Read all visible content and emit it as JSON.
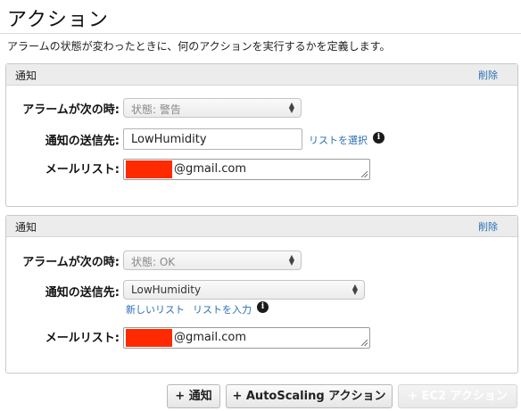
{
  "section": {
    "title": "アクション",
    "description": "アラームの状態が変わったときに、何のアクションを実行するかを定義します。"
  },
  "actions": [
    {
      "header": "通知",
      "delete_label": "削除",
      "alarm_label": "アラームが次の時:",
      "state_value": "状態: 警告",
      "send_to_label": "通知の送信先:",
      "send_to_value": "LowHumidity",
      "select_list_link": "リストを選択",
      "email_label": "メールリスト:",
      "email_value": "@gmail.com"
    },
    {
      "header": "通知",
      "delete_label": "削除",
      "alarm_label": "アラームが次の時:",
      "state_value": "状態: OK",
      "send_to_label": "通知の送信先:",
      "send_to_value": "LowHumidity",
      "new_list_link": "新しいリスト",
      "enter_list_link": "リストを入力",
      "email_label": "メールリスト:",
      "email_value": "@gmail.com"
    }
  ],
  "buttons": {
    "add_notification": "+ 通知",
    "add_autoscaling": "+ AutoScaling アクション",
    "add_ec2": "+ EC2 アクション"
  },
  "icons": {
    "info": "info-icon",
    "dropdown": "updown-arrows-icon"
  },
  "colors": {
    "link": "#2a6eb5",
    "redaction": "#ff2a00"
  }
}
